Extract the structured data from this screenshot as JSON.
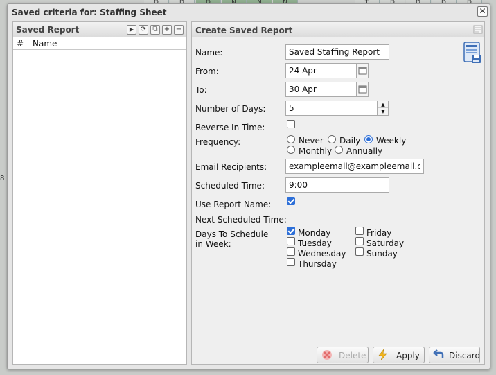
{
  "background": {
    "header_letters": [
      "D",
      "D",
      "D",
      "N",
      "N",
      "N",
      "",
      "",
      "",
      "",
      "",
      "",
      "",
      "",
      "T",
      "D",
      "D",
      "D",
      "D"
    ],
    "left_values": [
      "8"
    ]
  },
  "dialog": {
    "title": "Saved criteria for: Staffing Sheet",
    "close_symbol": "✕"
  },
  "saved_report": {
    "title": "Saved Report",
    "toolbar": {
      "run_symbol": "▶",
      "refresh_symbol": "⟳",
      "copy_symbol": "⧉",
      "add_symbol": "+",
      "remove_symbol": "−"
    },
    "columns": [
      "#",
      "Name"
    ],
    "rows": []
  },
  "create_report": {
    "title": "Create Saved Report",
    "name_label": "Name:",
    "name_value": "Saved Staffing Report",
    "from_label": "From:",
    "from_value": "24 Apr",
    "to_label": "To:",
    "to_value": "30 Apr",
    "days_label": "Number of Days:",
    "days_value": "5",
    "reverse_label": "Reverse In Time:",
    "reverse_checked": false,
    "frequency_label": "Frequency:",
    "frequency_options": [
      "Never",
      "Daily",
      "Weekly",
      "Monthly",
      "Annually"
    ],
    "frequency_selected": "Weekly",
    "email_label": "Email Recipients:",
    "email_value": "exampleemail@exampleemail.com",
    "time_label": "Scheduled Time:",
    "time_value": "9:00",
    "use_name_label": "Use Report Name:",
    "use_name_checked": true,
    "next_time_label": "Next Scheduled Time:",
    "next_time_value": "",
    "days_schedule_label": "Days To Schedule in Week:",
    "weekdays": [
      {
        "label": "Monday",
        "checked": true
      },
      {
        "label": "Tuesday",
        "checked": false
      },
      {
        "label": "Wednesday",
        "checked": false
      },
      {
        "label": "Thursday",
        "checked": false
      },
      {
        "label": "Friday",
        "checked": false
      },
      {
        "label": "Saturday",
        "checked": false
      },
      {
        "label": "Sunday",
        "checked": false
      }
    ]
  },
  "buttons": {
    "delete_label": "Delete",
    "apply_label": "Apply",
    "discard_label": "Discard"
  },
  "colors": {
    "accent": "#2d6fd8",
    "delete_icon": "#e26b6b",
    "apply_icon": "#f2b51f",
    "discard_icon": "#3f6fb6"
  }
}
